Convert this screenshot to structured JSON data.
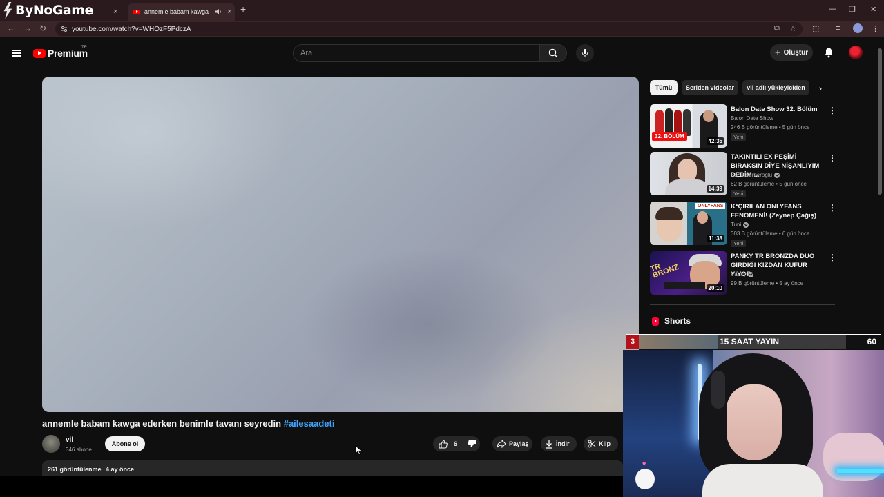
{
  "browser": {
    "logo_text": "ByNoGame",
    "active_tab_title": "annemle babam kawga ede",
    "url": "youtube.com/watch?v=WHQzF5PdczA",
    "new_tab": "+",
    "tab_close": "×"
  },
  "yt": {
    "logo_word": "Premium",
    "country": "TR",
    "search_placeholder": "Ara",
    "create_label": "Oluştur"
  },
  "video": {
    "title": "annemle babam kawga ederken benimle tavanı seyredin",
    "hashtag": "#ailesaadeti",
    "channel": "vil",
    "subscribers": "346 abone",
    "subscribe_label": "Abone ol",
    "likes": "6",
    "share_label": "Paylaş",
    "download_label": "İndir",
    "clip_label": "Klip",
    "views": "261 görüntülenme",
    "age": "4 ay önce"
  },
  "chips": [
    "Tümü",
    "Seriden videolar",
    "vil adlı yükleyiciden"
  ],
  "recommendations": [
    {
      "title": "Balon Date Show 32. Bölüm",
      "channel": "Balon Date Show",
      "verified": false,
      "meta": "246 B görüntüleme • 5 gün önce",
      "badge": "Yeni",
      "duration": "42:35",
      "thumb_label": "32. BÖLÜM"
    },
    {
      "title": "TAKINTILI EX PEŞİMİ BIRAKSIN DİYE NİŞANLIYIM DEDİM-...",
      "channel": "Banu Berberoglu",
      "verified": true,
      "meta": "62 B görüntüleme • 5 gün önce",
      "badge": "Yeni",
      "duration": "14:39"
    },
    {
      "title": "K*ÇIRILAN ONLYFANS FENOMENİ! (Zeynep Çağış)",
      "channel": "Tuni",
      "verified": true,
      "meta": "303 B görüntüleme • 6 gün önce",
      "badge": "Yeni",
      "duration": "11:38",
      "thumb_label": "ONLYFANS"
    },
    {
      "title": "PANKY TR BRONZDA DUO GİRDİĞİ KIZDAN KÜFÜR YİYOR",
      "channel": "Panky",
      "verified": true,
      "meta": "99 B görüntüleme • 5 ay önce",
      "badge": "",
      "duration": "20:10",
      "thumb_label": "TR BRONZ"
    }
  ],
  "shorts_label": "Shorts",
  "stream_overlay": {
    "count": "3",
    "label": "15 SAAT YAYIN",
    "goal": "60",
    "progress": 0.38
  },
  "colors": {
    "accent": "#ff0000",
    "hashtag": "#3ea6ff",
    "background": "#0f0f0f"
  },
  "icons": [
    "hamburger-icon",
    "search-icon",
    "mic-icon",
    "bell-icon",
    "like-icon",
    "dislike-icon",
    "share-icon",
    "download-icon",
    "scissors-icon",
    "kebab-icon",
    "chevron-right-icon"
  ]
}
